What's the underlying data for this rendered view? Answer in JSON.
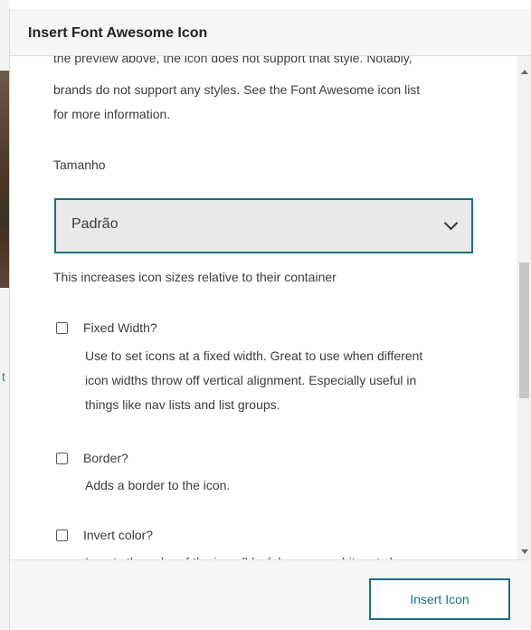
{
  "dialog": {
    "title": "Insert Font Awesome Icon"
  },
  "content": {
    "clipped_top_line": "the preview above, the icon does not support that style. Notably,",
    "styles_note_line1": "brands do not support any styles. See the Font Awesome icon list",
    "styles_note_line2": "for more information.",
    "size_label": "Tamanho",
    "size_select_value": "Padrão",
    "size_help": "This increases icon sizes relative to their container",
    "options": [
      {
        "label": "Fixed Width?",
        "desc_lines": [
          "Use to set icons at a fixed width. Great to use when different",
          "icon widths throw off vertical alignment. Especially useful in",
          "things like nav lists and list groups."
        ]
      },
      {
        "label": "Border?",
        "desc_lines": [
          "Adds a border to the icon."
        ]
      },
      {
        "label": "Invert color?",
        "desc_lines": [
          "Inverts the color of the icon (black becomes white, etc.)"
        ]
      }
    ]
  },
  "footer": {
    "insert_label": "Insert Icon"
  },
  "background": {
    "link_fragment": "t"
  },
  "colors": {
    "accent": "#1d6f7d",
    "select_bg": "#e9e9e9",
    "header_bg": "#f6f6f6"
  }
}
